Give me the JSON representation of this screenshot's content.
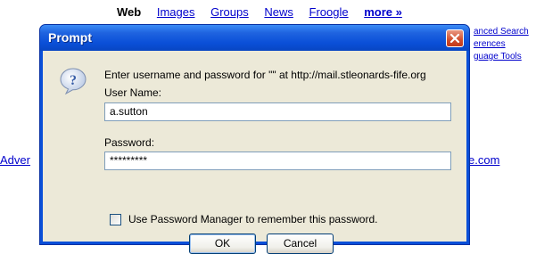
{
  "google": {
    "nav": {
      "web": "Web",
      "images": "Images",
      "groups": "Groups",
      "news": "News",
      "froogle": "Froogle",
      "more": "more »"
    },
    "side_links": [
      "anced Search",
      "erences",
      "guage Tools"
    ],
    "adv_fragment": "Adver",
    "dotcom_fragment": "e.com"
  },
  "dialog": {
    "title": "Prompt",
    "message": "Enter username and password for \"\" at http://mail.stleonards-fife.org",
    "username_label": "User Name:",
    "username_value": "a.sutton",
    "password_label": "Password:",
    "password_value": "*********",
    "remember_label": "Use Password Manager to remember this password.",
    "remember_checked": false,
    "ok_label": "OK",
    "cancel_label": "Cancel"
  },
  "colors": {
    "titlebar": "#0a4fd8",
    "client": "#ece9d8",
    "link": "#0000cc",
    "close": "#d24d2c"
  },
  "icons": [
    "question-icon",
    "close-icon"
  ]
}
